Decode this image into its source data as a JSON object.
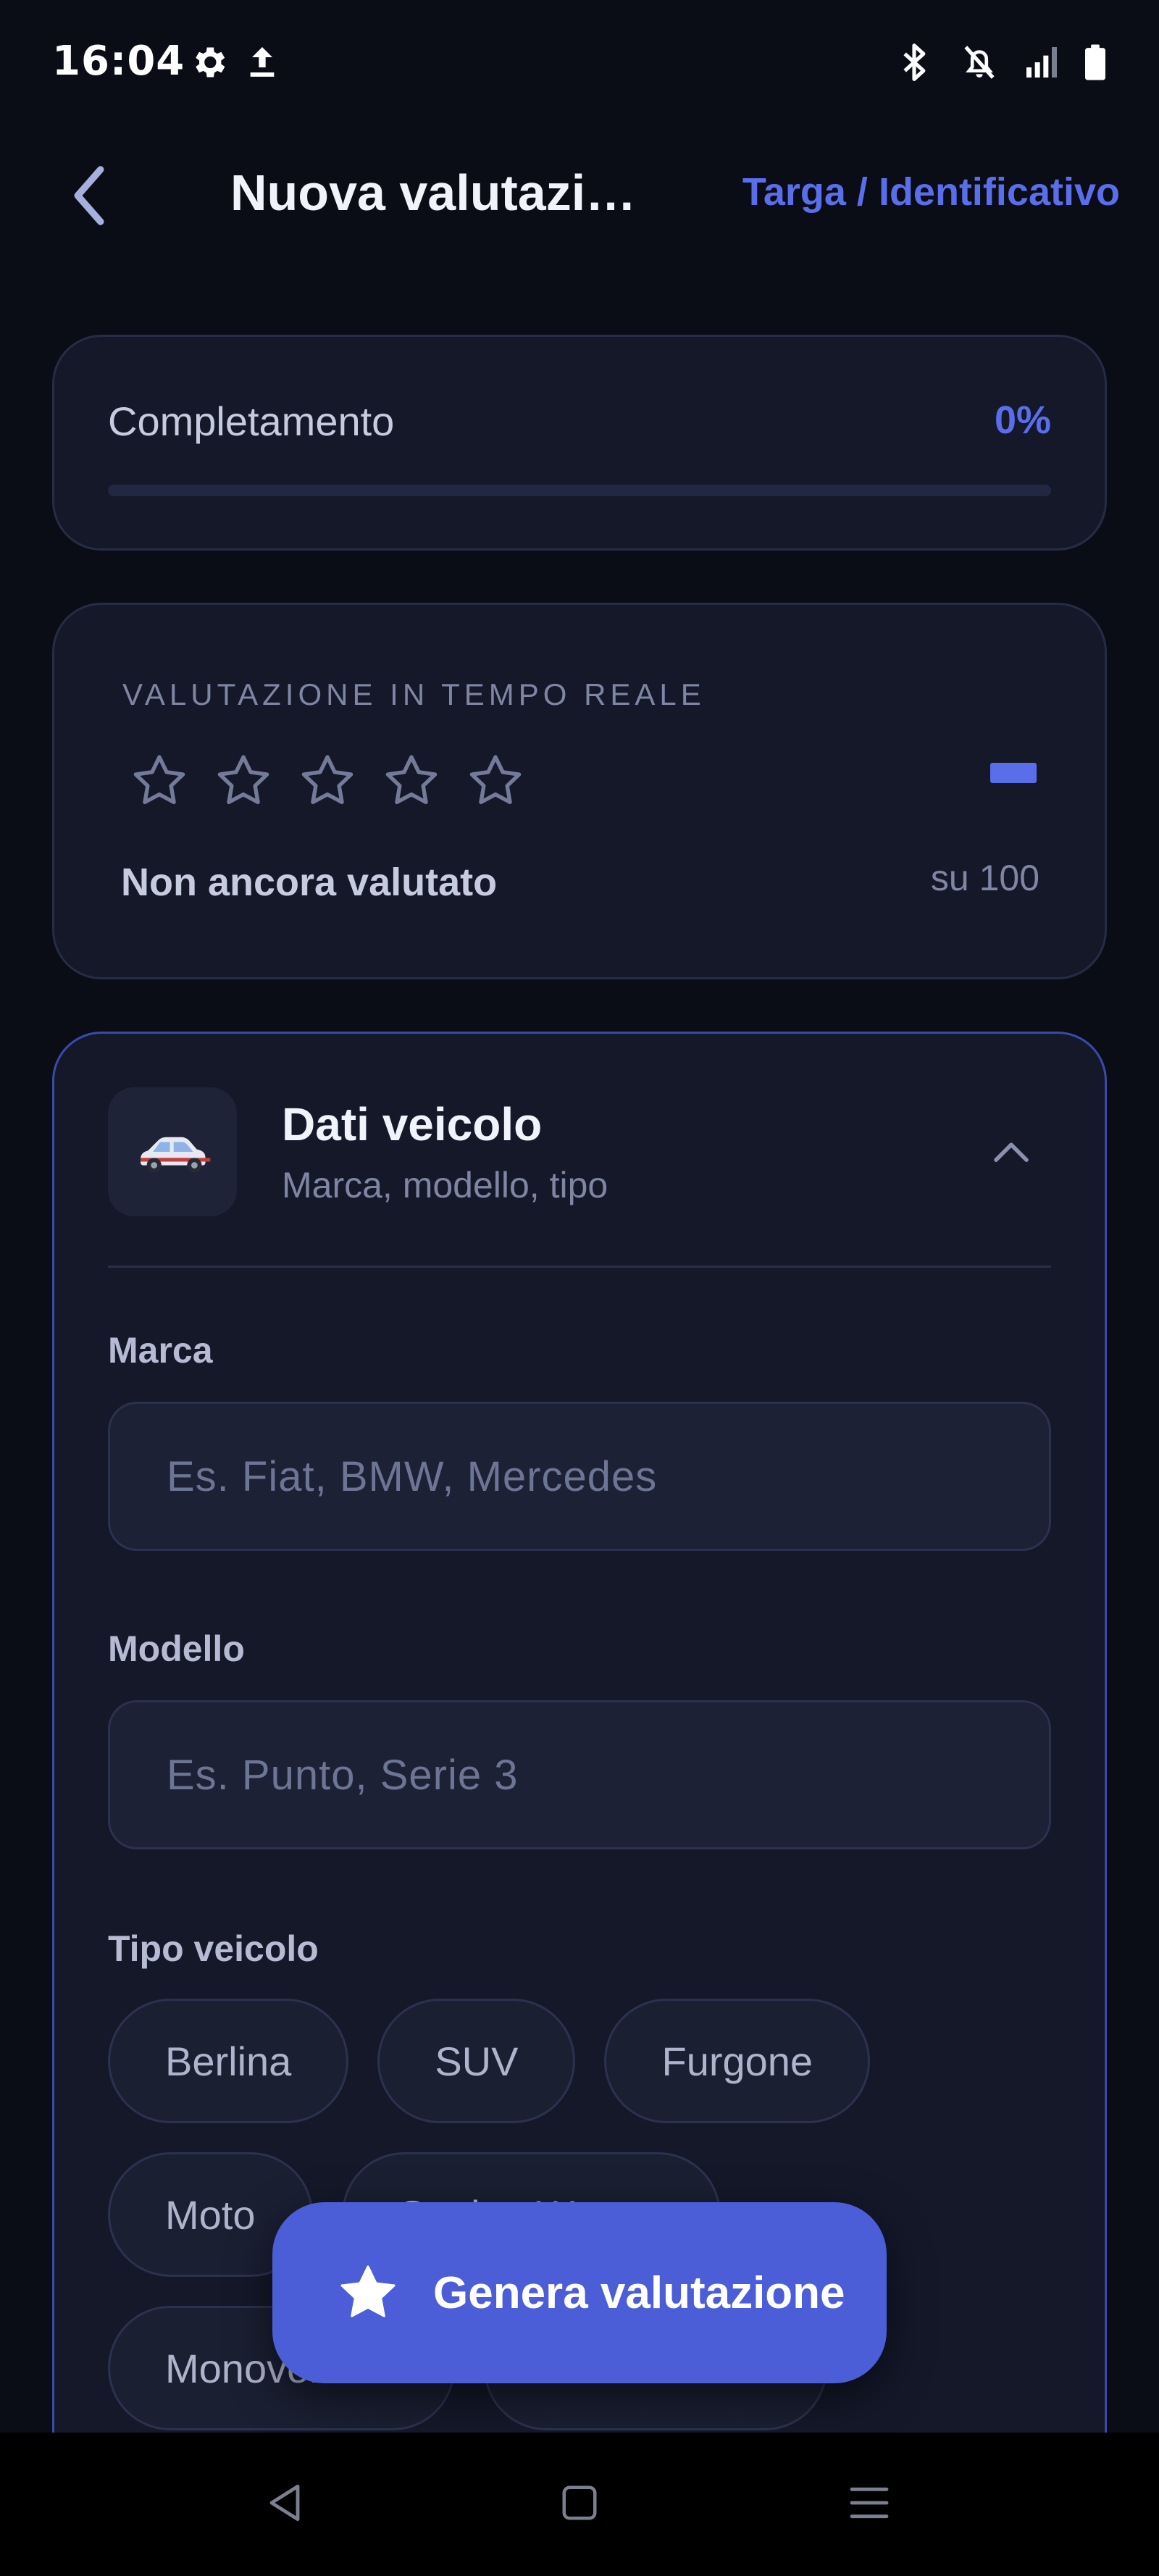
{
  "status_bar": {
    "time": "16:04",
    "left_icons": [
      "gear-icon",
      "upload-icon"
    ],
    "right_icons": [
      "bluetooth-icon",
      "notifications-off-icon",
      "signal-icon",
      "battery-icon"
    ]
  },
  "app_bar": {
    "back_icon": "chevron-left-icon",
    "title": "Nuova valutazi…",
    "action_label": "Targa / Identificativo"
  },
  "progress": {
    "label": "Completamento",
    "value_text": "0%",
    "fraction": 0
  },
  "rating": {
    "eyebrow": "VALUTAZIONE IN TEMPO REALE",
    "stars_total": 5,
    "stars_filled": 0,
    "status": "Non ancora valutato",
    "score": "–",
    "scale": "su 100"
  },
  "vehicle_section": {
    "icon": "car-icon",
    "title": "Dati veicolo",
    "subtitle": "Marca, modello, tipo",
    "collapse_icon": "chevron-up-icon",
    "brand": {
      "label": "Marca",
      "value": "",
      "placeholder": "Es. Fiat, BMW, Mercedes"
    },
    "model": {
      "label": "Modello",
      "value": "",
      "placeholder": "Es. Punto, Serie 3"
    },
    "type": {
      "label": "Tipo veicolo",
      "options": [
        "Berlina",
        "SUV",
        "Furgone",
        "Moto",
        "Station Wagon",
        "Monovolume",
        ""
      ]
    }
  },
  "fab": {
    "icon": "star-icon",
    "label": "Genera valutazione"
  },
  "nav_bar": {
    "icons": [
      "back-triangle-icon",
      "home-square-icon",
      "menu-icon"
    ]
  },
  "colors": {
    "background": "#0a0c16",
    "card": "#141829",
    "accent": "#5a6eea",
    "fab": "#4b5ed8",
    "muted_text": "#7e86a4"
  }
}
